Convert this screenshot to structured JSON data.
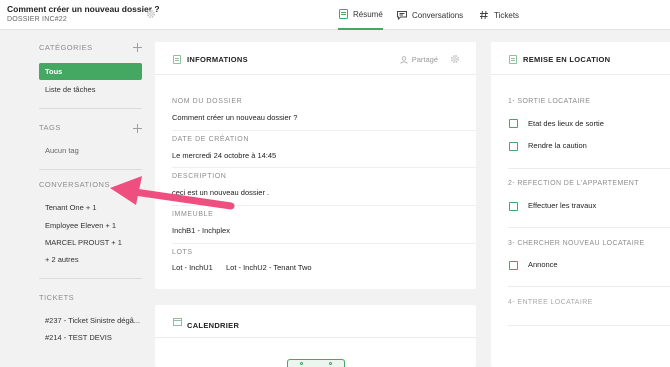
{
  "header": {
    "title": "Comment créer un nouveau dossier ?",
    "subtitle": "DOSSIER INC#22"
  },
  "tabs": [
    {
      "label": "Résumé",
      "icon": "document-icon",
      "active": true
    },
    {
      "label": "Conversations",
      "icon": "chat-icon",
      "active": false
    },
    {
      "label": "Tickets",
      "icon": "hash-icon",
      "active": false
    }
  ],
  "sidebar": {
    "categories_title": "CATÉGORIES",
    "categories": [
      "Tous",
      "Liste de tâches"
    ],
    "tags_title": "TAGS",
    "tags_empty": "Aucun tag",
    "conversations_title": "CONVERSATIONS",
    "conversations": [
      "Tenant One + 1",
      "Employee Eleven + 1",
      "MARCEL PROUST + 1",
      "+ 2 autres"
    ],
    "tickets_title": "TICKETS",
    "tickets": [
      "#237 - Ticket Sinistre dégâ...",
      "#214 - TEST DEVIS"
    ]
  },
  "info": {
    "title": "INFORMATIONS",
    "shared": "Partagé",
    "fields": [
      {
        "label": "NOM DU DOSSIER",
        "value": "Comment créer un nouveau dossier ?"
      },
      {
        "label": "DATE DE CRÉATION",
        "value": "Le mercredi 24 octobre à 14:45"
      },
      {
        "label": "DESCRIPTION",
        "value": "ceci est un nouveau dossier ."
      },
      {
        "label": "IMMEUBLE",
        "value": "InchB1 - Inchplex"
      }
    ],
    "lots_label": "LOTS",
    "lots": [
      "Lot - InchU1",
      "Lot - InchU2 - Tenant Two"
    ]
  },
  "calendar": {
    "title": "CALENDRIER"
  },
  "remise": {
    "title": "REMISE EN LOCATION",
    "steps": [
      {
        "title": "1- SORTIE LOCATAIRE",
        "tasks": [
          "Etat des lieux de sortie",
          "Rendre la caution"
        ]
      },
      {
        "title": "2- REFECTION DE L'APPARTEMENT",
        "tasks": [
          "Effectuer les travaux"
        ]
      },
      {
        "title": "3- CHERCHER NOUVEAU LOCATAIRE",
        "tasks": [
          "Annonce"
        ]
      },
      {
        "title": "4- ENTREE LOCATAIRE",
        "tasks": []
      }
    ]
  },
  "colors": {
    "accent": "#44a862",
    "annotation_arrow": "#ef4f7f"
  }
}
